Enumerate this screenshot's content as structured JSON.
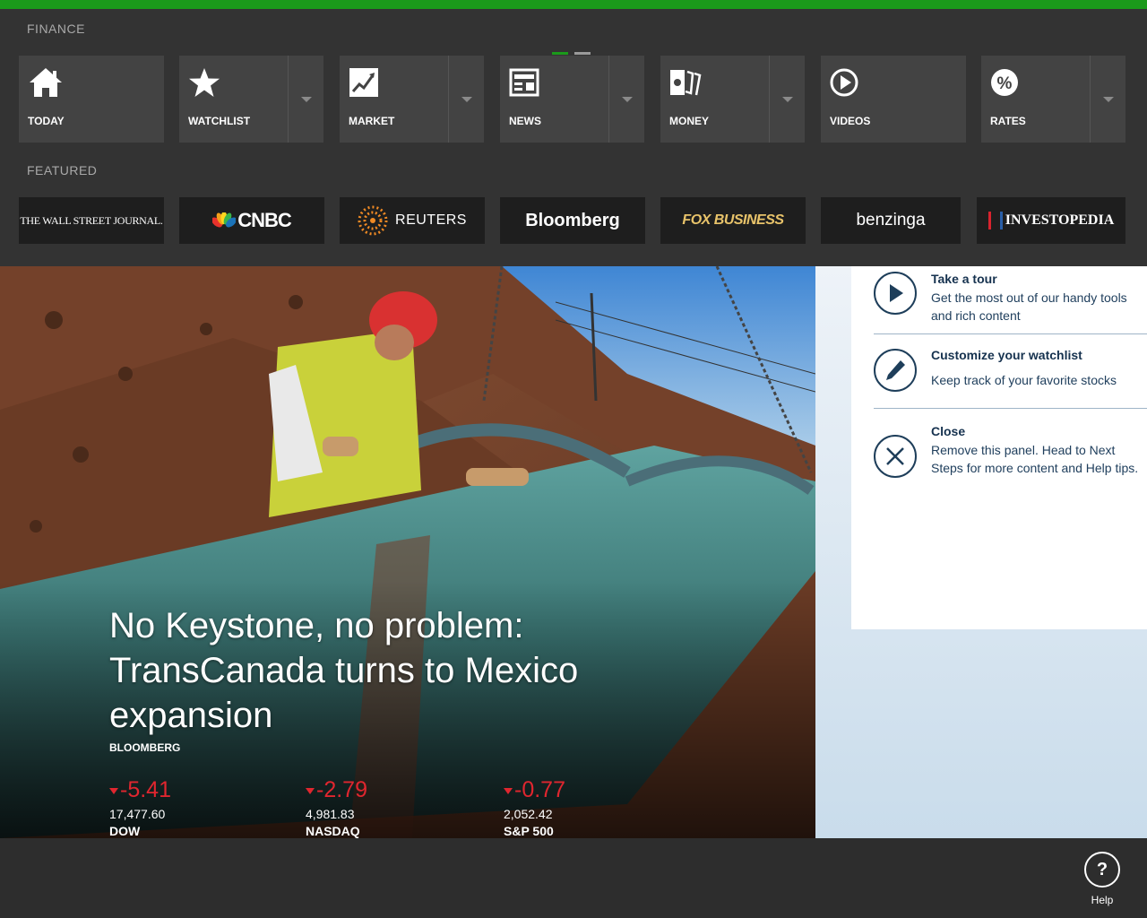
{
  "colors": {
    "accent": "#1b9a1b",
    "panel": "#333333",
    "tile": "#434343",
    "negative": "#e0262f",
    "tip_text": "#16324f"
  },
  "app": {
    "title": "FINANCE"
  },
  "featured_label": "FEATURED",
  "nav": [
    {
      "label": "TODAY",
      "icon": "home-icon",
      "dropdown": false
    },
    {
      "label": "WATCHLIST",
      "icon": "star-icon",
      "dropdown": true
    },
    {
      "label": "MARKET",
      "icon": "chart-icon",
      "dropdown": true
    },
    {
      "label": "NEWS",
      "icon": "newspaper-icon",
      "dropdown": true
    },
    {
      "label": "MONEY",
      "icon": "money-icon",
      "dropdown": true
    },
    {
      "label": "VIDEOS",
      "icon": "play-icon",
      "dropdown": false
    },
    {
      "label": "RATES",
      "icon": "percent-icon",
      "dropdown": true
    }
  ],
  "featured": [
    {
      "name": "THE WALL STREET JOURNAL."
    },
    {
      "name": "CNBC"
    },
    {
      "name": "REUTERS"
    },
    {
      "name": "Bloomberg"
    },
    {
      "name": "FOX BUSINESS"
    },
    {
      "name": "benzinga"
    },
    {
      "name": "INVESTOPEDIA"
    }
  ],
  "hero": {
    "headline": "No Keystone, no problem: TransCanada turns to Mexico expansion",
    "source": "BLOOMBERG"
  },
  "tickers": [
    {
      "change": "-5.41",
      "value": "17,477.60",
      "name": "DOW"
    },
    {
      "change": "-2.79",
      "value": "4,981.83",
      "name": "NASDAQ"
    },
    {
      "change": "-0.77",
      "value": "2,052.42",
      "name": "S&P 500"
    }
  ],
  "tips": [
    {
      "title": "Take a tour",
      "text": "Get the most out of our handy tools and rich content",
      "icon": "play-icon"
    },
    {
      "title": "Customize your watchlist",
      "text": "Keep track of your favorite stocks",
      "icon": "pencil-icon"
    },
    {
      "title": "Close",
      "text": "Remove this panel. Head to Next Steps for more content and Help tips.",
      "icon": "close-icon"
    }
  ],
  "help": {
    "label": "Help",
    "glyph": "?"
  }
}
